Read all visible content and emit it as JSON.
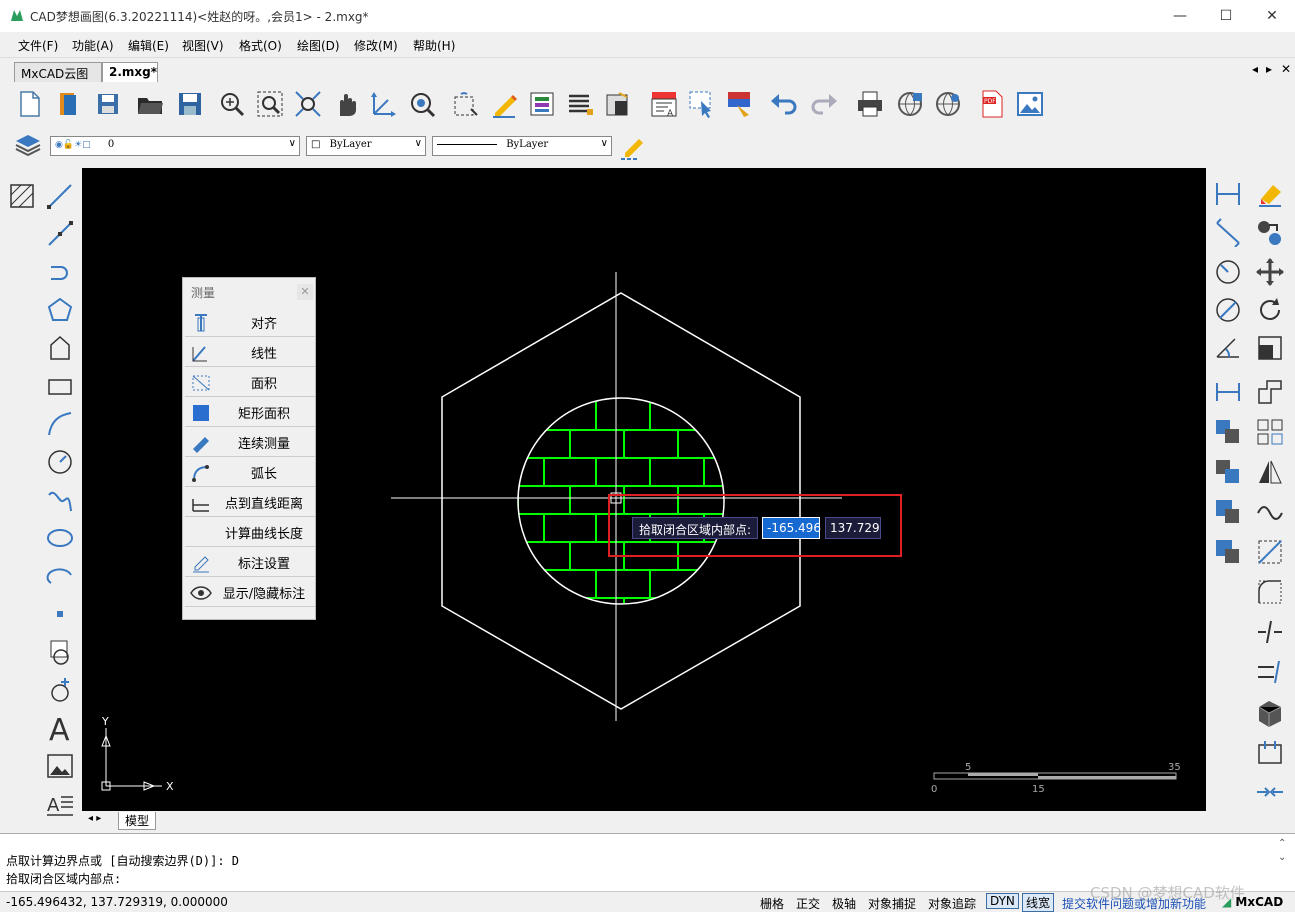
{
  "window": {
    "title": "CAD梦想画图(6.3.20221114)<姓赵的呀。,会员1> - 2.mxg*",
    "minimize": "—",
    "maximize": "☐",
    "close": "✕"
  },
  "menu": [
    "文件(F)",
    "功能(A)",
    "编辑(E)",
    "视图(V)",
    "格式(O)",
    "绘图(D)",
    "修改(M)",
    "帮助(H)"
  ],
  "tabs": [
    {
      "label": "MxCAD云图",
      "active": false
    },
    {
      "label": "2.mxg*",
      "active": true
    }
  ],
  "tab_nav": [
    "◂",
    "▸",
    "✕"
  ],
  "properties": {
    "layer": "0",
    "color": "ByLayer",
    "linetype": "ByLayer"
  },
  "measure_panel": {
    "title": "测量",
    "close": "✕",
    "items": [
      "对齐",
      "线性",
      "面积",
      "矩形面积",
      "连续测量",
      "弧长",
      "点到直线距离",
      "计算曲线长度",
      "标注设置",
      "显示/隐藏标注"
    ]
  },
  "dynamic_input": {
    "prompt": "拾取闭合区域内部点:",
    "x_value": "-165.496",
    "y_value": "137.729"
  },
  "scale_bar": {
    "top_labels": [
      "5",
      "35"
    ],
    "bottom_labels": [
      "0",
      "15"
    ]
  },
  "axes": {
    "y_label": "Y",
    "x_label": "X"
  },
  "layout_tabs": {
    "model": "模型"
  },
  "command_lines": [
    "点取计算边界点或 [自动搜索边界(D)]: D",
    "拾取闭合区域内部点:"
  ],
  "status": {
    "coordinates": "-165.496432,  137.729319,  0.000000",
    "toggles": [
      {
        "label": "栅格",
        "on": false
      },
      {
        "label": "正交",
        "on": false
      },
      {
        "label": "极轴",
        "on": false
      },
      {
        "label": "对象捕捉",
        "on": false
      },
      {
        "label": "对象追踪",
        "on": false
      },
      {
        "label": "DYN",
        "on": true
      },
      {
        "label": "线宽",
        "on": true
      }
    ],
    "feedback_link": "提交软件问题或增加新功能",
    "brand": "MxCAD",
    "watermark": "CSDN @梦想CAD软件"
  },
  "colors": {
    "canvas": "#000000",
    "hatch": "#00ff00",
    "geometry": "#ffffff",
    "highlight": "#e02020",
    "dyn_active": "#1769d2"
  }
}
